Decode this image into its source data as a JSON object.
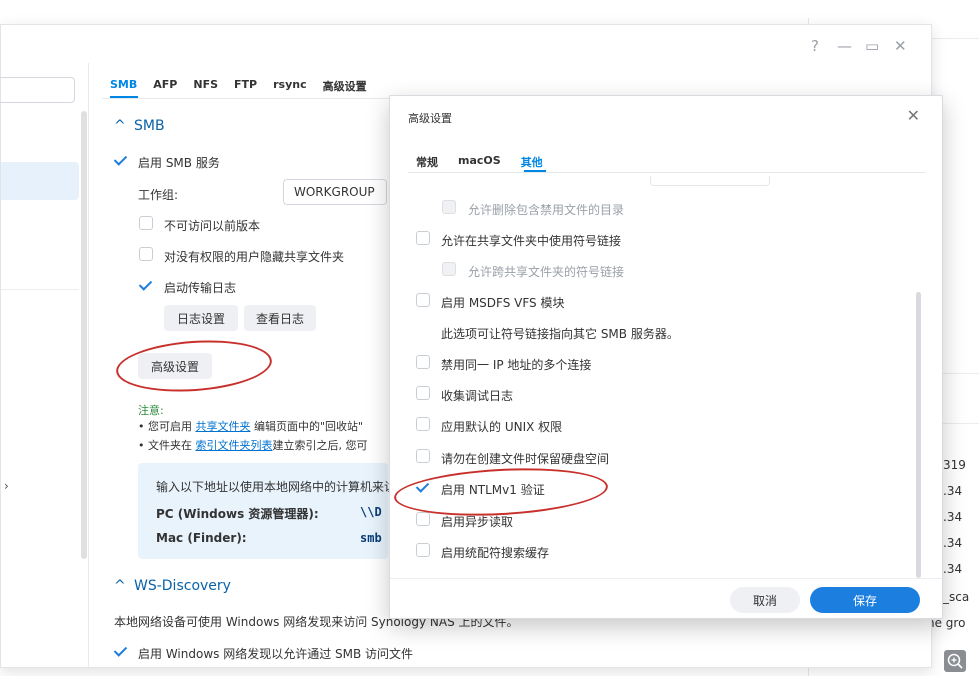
{
  "background_window": {
    "rows": [
      "319",
      ".34",
      ".34",
      ".34",
      ".34",
      "_sca",
      "he gro"
    ]
  },
  "main_window": {
    "controls": [
      "?",
      "—",
      "▭",
      "✕"
    ],
    "tabs": [
      "SMB",
      "AFP",
      "NFS",
      "FTP",
      "rsync",
      "高级设置"
    ],
    "smb_section": {
      "header": "SMB",
      "enable_smb": "启用 SMB 服务",
      "workgroup_label": "工作组:",
      "workgroup_value": "WORKGROUP",
      "no_previous_versions": "不可访问以前版本",
      "hide_unauthorized": "对没有权限的用户隐藏共享文件夹",
      "enable_transfer_log": "启动传输日志",
      "log_settings_button": "日志设置",
      "view_log_button": "查看日志",
      "advanced_button": "高级设置"
    },
    "note": {
      "title": "注意:",
      "line1_prefix": "• 您可启用 ",
      "line1_link": "共享文件夹",
      "line1_suffix": " 编辑页面中的\"回收站\"",
      "line2_prefix": "• 文件夹在 ",
      "line2_link": "索引文件夹列表",
      "line2_suffix": "建立索引之后, 您可"
    },
    "info_box": {
      "intro": "输入以下地址以使用本地网络中的计算机来访",
      "pc_label": "PC (Windows 资源管理器):",
      "pc_value": "\\\\D",
      "mac_label": "Mac (Finder):",
      "mac_value": "smb"
    },
    "ws_section": {
      "header": "WS-Discovery",
      "desc": "本地网络设备可使用 Windows 网络发现来访问 Synology NAS 上的文件。",
      "enable_ws": "启用 Windows 网络发现以允许通过 SMB 访问文件"
    }
  },
  "modal": {
    "title": "高级设置",
    "tabs": [
      "常规",
      "macOS",
      "其他"
    ],
    "options": [
      {
        "label": "允许删除包含禁用文件的目录",
        "state": "disabled"
      },
      {
        "label": "允许在共享文件夹中使用符号链接",
        "state": "off"
      },
      {
        "label": "允许跨共享文件夹的符号链接",
        "state": "disabled"
      },
      {
        "label": "启用 MSDFS VFS 模块",
        "state": "off"
      },
      {
        "label": "此选项可让符号链接指向其它 SMB 服务器。",
        "state": "text"
      },
      {
        "label": "禁用同一 IP 地址的多个连接",
        "state": "off"
      },
      {
        "label": "收集调试日志",
        "state": "off"
      },
      {
        "label": "应用默认的 UNIX 权限",
        "state": "off"
      },
      {
        "label": "请勿在创建文件时保留硬盘空间",
        "state": "off"
      },
      {
        "label": "启用 NTLMv1 验证",
        "state": "on"
      },
      {
        "label": "启用异步读取",
        "state": "off"
      },
      {
        "label": "启用统配符搜索缓存",
        "state": "off"
      }
    ],
    "cancel": "取消",
    "save": "保存"
  },
  "colors": {
    "accent": "#0086e5",
    "highlight_ellipse": "#c8302c",
    "primary_button": "#1c7fe0"
  }
}
